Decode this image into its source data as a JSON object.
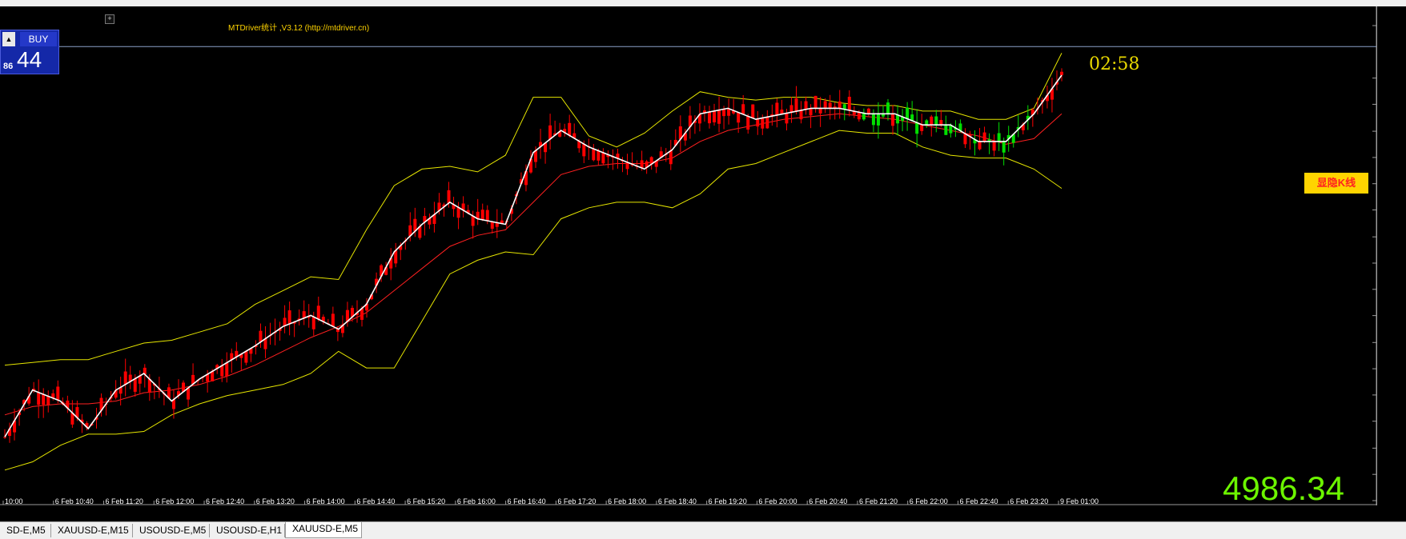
{
  "indicator_label": "MTDriver统计 ,V3.12 (http://mtdriver.cn)",
  "buy_panel": {
    "button_label": "BUY",
    "price_small": "86",
    "price_big": "44"
  },
  "countdown": "02:58",
  "kline_toggle_label": "显隐K线",
  "current_price": "4986.34",
  "price_line_label": "4986.34",
  "tabs": [
    {
      "label": "SD-E,M5",
      "active": false
    },
    {
      "label": "XAUUSD-E,M15",
      "active": false
    },
    {
      "label": "USOUSD-E,M5",
      "active": false
    },
    {
      "label": "USOUSD-E,H1",
      "active": false
    },
    {
      "label": "XAUUSD-E,M5",
      "active": true
    }
  ],
  "colors": {
    "background": "#000000",
    "up_candle": "#00e000",
    "down_candle": "#ff0000",
    "ma_fast": "#ffffff",
    "ma_slow": "#ff2020",
    "bollinger": "#e6e600",
    "axis_text": "#ffffff",
    "price_line": "#8aa0c8"
  },
  "chart_data": {
    "type": "candlestick",
    "symbol": "XAUUSD-E",
    "timeframe": "M5",
    "y_ticks": [
      "4993.95",
      "4974.95",
      "4965.45",
      "4955.70",
      "4946.20",
      "4936.70",
      "4927.20",
      "4917.45",
      "4907.95",
      "4898.45",
      "4888.95",
      "4879.20",
      "4869.70",
      "4860.20",
      "4850.70",
      "4840.95",
      "4831.45",
      "4821.95"
    ],
    "ylim": [
      4821.95,
      4993.95
    ],
    "x_ticks": [
      "10:00",
      "6 Feb 10:40",
      "6 Feb 11:20",
      "6 Feb 12:00",
      "6 Feb 12:40",
      "6 Feb 13:20",
      "6 Feb 14:00",
      "6 Feb 14:40",
      "6 Feb 15:20",
      "6 Feb 16:00",
      "6 Feb 16:40",
      "6 Feb 17:20",
      "6 Feb 18:00",
      "6 Feb 18:40",
      "6 Feb 19:20",
      "6 Feb 20:00",
      "6 Feb 20:40",
      "6 Feb 21:20",
      "6 Feb 22:00",
      "6 Feb 22:40",
      "6 Feb 23:20",
      "9 Feb 01:00"
    ],
    "ma_fast": [
      4845,
      4862,
      4858,
      4848,
      4862,
      4868,
      4858,
      4866,
      4872,
      4878,
      4885,
      4889,
      4884,
      4893,
      4912,
      4922,
      4930,
      4924,
      4922,
      4948,
      4956,
      4950,
      4946,
      4942,
      4949,
      4962,
      4964,
      4960,
      4962,
      4964,
      4964,
      4962,
      4962,
      4958,
      4958,
      4952,
      4952,
      4962,
      4976
    ],
    "ma_slow": [
      4853,
      4856,
      4857,
      4857,
      4858,
      4861,
      4862,
      4864,
      4867,
      4871,
      4876,
      4881,
      4885,
      4890,
      4898,
      4906,
      4914,
      4918,
      4920,
      4930,
      4940,
      4943,
      4944,
      4944,
      4946,
      4952,
      4956,
      4958,
      4960,
      4961,
      4962,
      4961,
      4960,
      4958,
      4956,
      4954,
      4951,
      4953,
      4962
    ],
    "bb_upper": [
      4871,
      4872,
      4873,
      4873,
      4876,
      4879,
      4880,
      4883,
      4886,
      4893,
      4898,
      4903,
      4902,
      4920,
      4936,
      4942,
      4943,
      4941,
      4947,
      4968,
      4968,
      4954,
      4950,
      4955,
      4963,
      4970,
      4968,
      4967,
      4968,
      4968,
      4966,
      4965,
      4965,
      4963,
      4963,
      4960,
      4960,
      4964,
      4984
    ],
    "bb_lower": [
      4833,
      4836,
      4842,
      4846,
      4846,
      4847,
      4853,
      4857,
      4860,
      4862,
      4864,
      4868,
      4876,
      4870,
      4870,
      4887,
      4904,
      4909,
      4912,
      4911,
      4924,
      4928,
      4930,
      4930,
      4928,
      4933,
      4942,
      4944,
      4948,
      4952,
      4956,
      4955,
      4955,
      4950,
      4947,
      4946,
      4946,
      4942,
      4935
    ]
  }
}
